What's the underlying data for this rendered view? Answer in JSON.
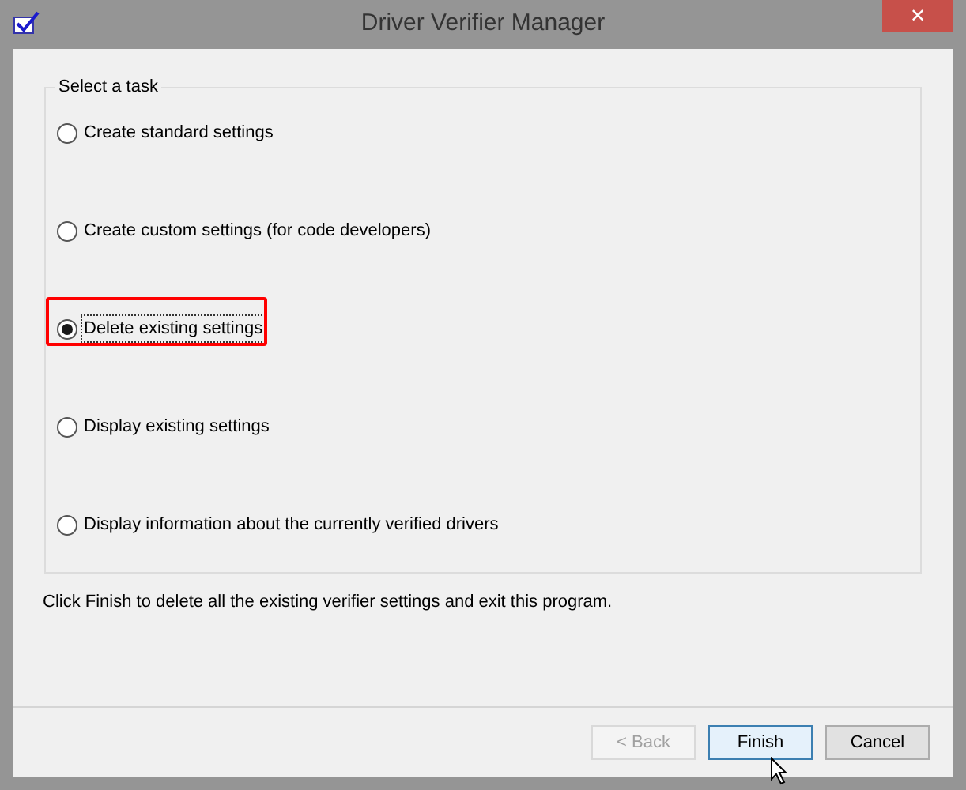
{
  "window": {
    "title": "Driver Verifier Manager",
    "close": "✕"
  },
  "group": {
    "title": "Select a task",
    "options": [
      {
        "label": "Create standard settings",
        "selected": false,
        "highlighted": false
      },
      {
        "label": "Create custom settings (for code developers)",
        "selected": false,
        "highlighted": false
      },
      {
        "label": "Delete existing settings",
        "selected": true,
        "highlighted": true
      },
      {
        "label": "Display existing settings",
        "selected": false,
        "highlighted": false
      },
      {
        "label": "Display information about the currently verified drivers",
        "selected": false,
        "highlighted": false
      }
    ]
  },
  "description": "Click Finish to delete all the existing verifier settings and exit this program.",
  "buttons": [
    {
      "label": "< Back",
      "disabled": true,
      "default": false
    },
    {
      "label": "Finish",
      "disabled": false,
      "default": true
    },
    {
      "label": "Cancel",
      "disabled": false,
      "default": false
    }
  ]
}
